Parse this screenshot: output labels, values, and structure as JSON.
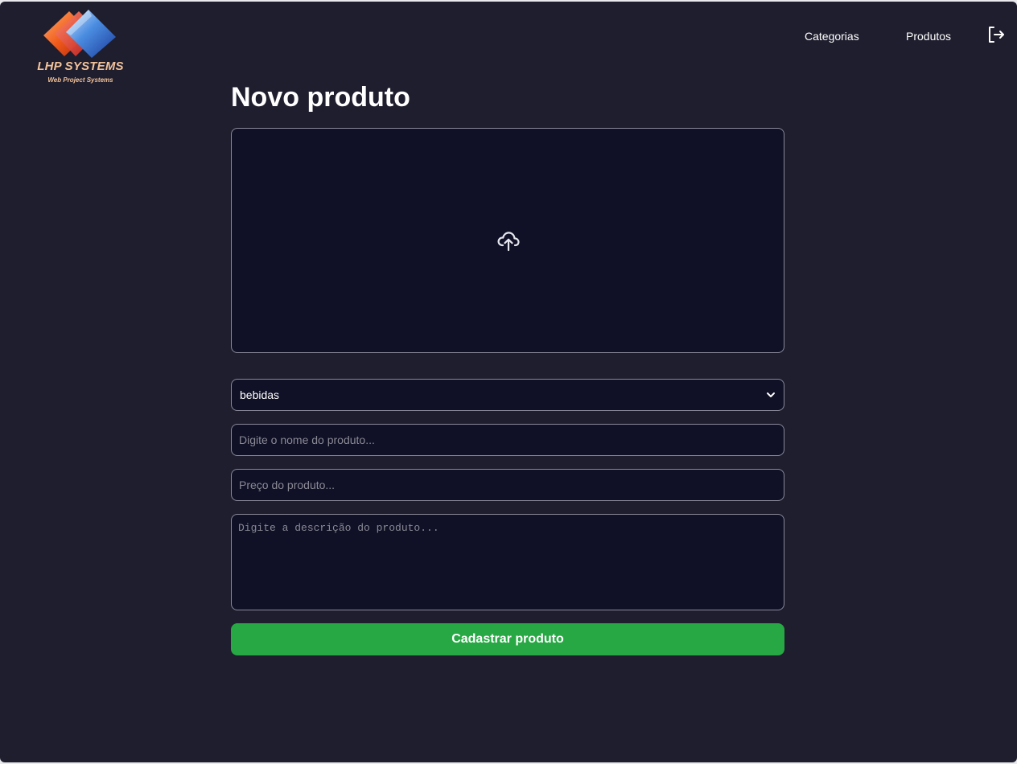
{
  "header": {
    "logo": {
      "title": "LHP SYSTEMS",
      "subtitle": "Web Project Systems"
    },
    "nav": [
      {
        "label": "Categorias"
      },
      {
        "label": "Produtos"
      }
    ],
    "logout_icon": "logout-icon"
  },
  "main": {
    "title": "Novo produto",
    "upload_icon": "cloud-upload-icon",
    "category_select": {
      "selected": "bebidas"
    },
    "name_input": {
      "value": "",
      "placeholder": "Digite o nome do produto..."
    },
    "price_input": {
      "value": "",
      "placeholder": "Preço do produto..."
    },
    "description_input": {
      "value": "",
      "placeholder": "Digite a descrição do produto..."
    },
    "submit_label": "Cadastrar produto"
  },
  "colors": {
    "background": "#1f1e2e",
    "input_background": "#101026",
    "border": "#8a8a9a",
    "submit": "#27a844",
    "logo_text": "#f3c39a"
  }
}
